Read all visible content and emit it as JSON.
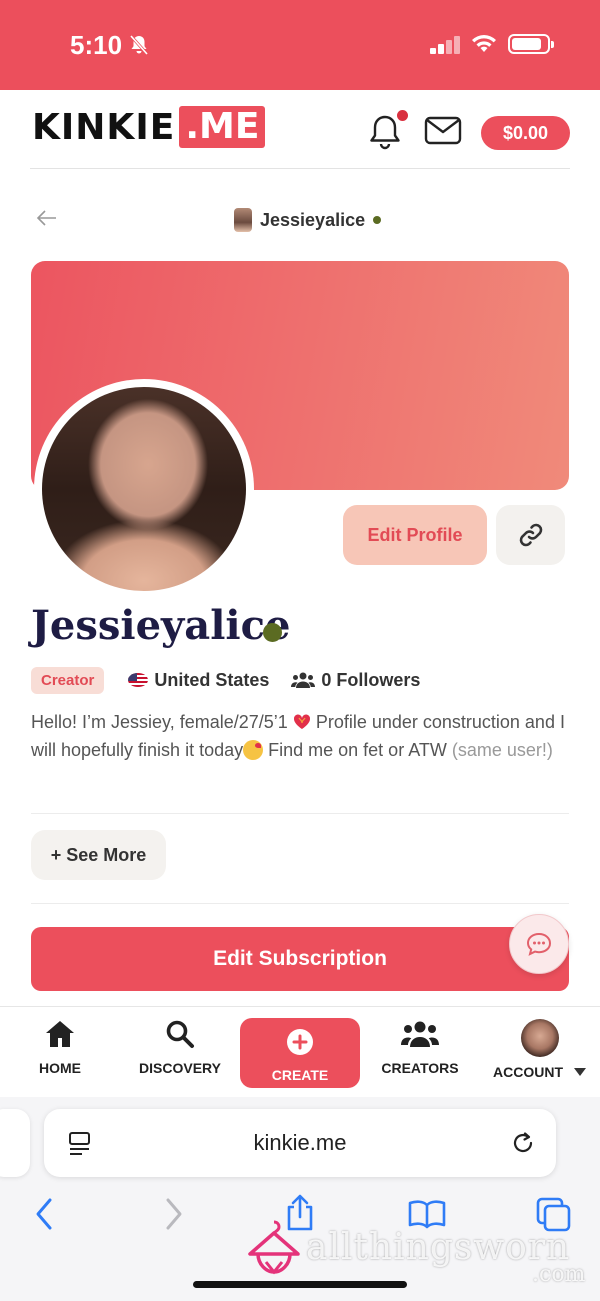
{
  "status_bar": {
    "time": "5:10",
    "battery_level": 0.85
  },
  "header": {
    "logo_left": "KINKIE",
    "logo_right": ".ME",
    "balance": "$0.00",
    "brand_color": "#ec4f5c"
  },
  "subheader": {
    "username": "Jessieyalice"
  },
  "profile": {
    "name": "Jessieyalice",
    "online": true,
    "badge": "Creator",
    "country": "United States",
    "followers": "0 Followers",
    "bio_part1": "Hello! I’m Jessiey, female/27/5’1",
    "bio_part2": "Profile under construction and I will hopefully finish it today",
    "bio_part3": "Find me on fet or ATW",
    "bio_part4": "(same user!)",
    "edit_profile_label": "Edit Profile",
    "see_more_label": "+ See More",
    "edit_subscription_label": "Edit Subscription"
  },
  "bottom_nav": {
    "items": [
      {
        "label": "HOME",
        "icon": "home-icon"
      },
      {
        "label": "DISCOVERY",
        "icon": "search-icon"
      },
      {
        "label": "CREATE",
        "icon": "plus-circle-icon"
      },
      {
        "label": "CREATORS",
        "icon": "users-icon"
      },
      {
        "label": "ACCOUNT",
        "icon": "avatar"
      }
    ]
  },
  "browser": {
    "url": "kinkie.me",
    "watermark": "allthingsworn",
    "watermark_sub": ".com"
  }
}
